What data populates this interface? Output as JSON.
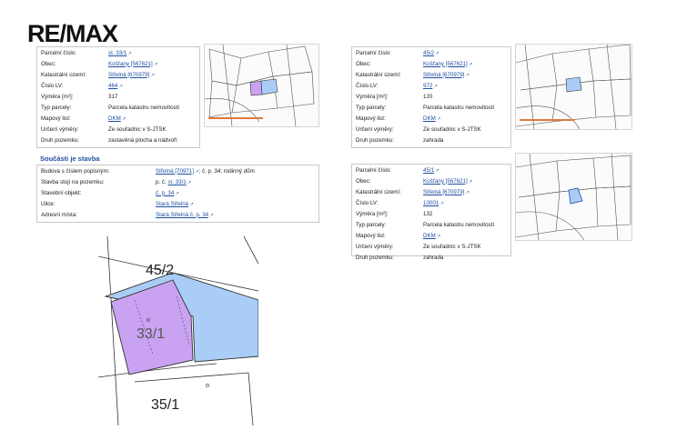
{
  "logo": {
    "brand": "RE/MAX"
  },
  "parcel1": {
    "rows": [
      {
        "label": "Parcelní číslo:",
        "value": "st. 33/1",
        "link": true
      },
      {
        "label": "Obec:",
        "value": "Košťany [567621]",
        "link": true
      },
      {
        "label": "Katastrální území:",
        "value": "Střelná [670979]",
        "link": true
      },
      {
        "label": "Číslo LV:",
        "value": "464",
        "link": true
      },
      {
        "label": "Výměra [m²]:",
        "value": "317",
        "link": false
      },
      {
        "label": "Typ parcely:",
        "value": "Parcela katastru nemovitostí",
        "link": false
      },
      {
        "label": "Mapový list:",
        "value": "DKM",
        "link": true
      },
      {
        "label": "Určení výměry:",
        "value": "Ze souřadnic v S-JTSK",
        "link": false
      },
      {
        "label": "Druh pozemku:",
        "value": "zastavěná plocha a nádvoří",
        "link": false
      }
    ]
  },
  "stavba": {
    "title": "Součásti je stavba",
    "rows": [
      {
        "label": "Budova s číslem popisným:",
        "value": "Střelná [70971]",
        "suffix": "; č. p. 34; rodinný dům",
        "link": true
      },
      {
        "label": "Stavba stojí na pozemku:",
        "prefix": "p. č.",
        "value": "st. 33/1",
        "link": true
      },
      {
        "label": "Stavební objekt:",
        "value": "č. p. 34",
        "link": true
      },
      {
        "label": "Ulice:",
        "value": "Stará Střelná",
        "link": true
      },
      {
        "label": "Adresní místa:",
        "value": "Stará Střelná č. p. 34",
        "link": true
      }
    ]
  },
  "parcel2": {
    "rows": [
      {
        "label": "Parcelní číslo:",
        "value": "45/2",
        "link": true
      },
      {
        "label": "Obec:",
        "value": "Košťany [567621]",
        "link": true
      },
      {
        "label": "Katastrální území:",
        "value": "Střelná [670979]",
        "link": true
      },
      {
        "label": "Číslo LV:",
        "value": "972",
        "link": true
      },
      {
        "label": "Výměra [m²]:",
        "value": "120",
        "link": false
      },
      {
        "label": "Typ parcely:",
        "value": "Parcela katastru nemovitostí",
        "link": false
      },
      {
        "label": "Mapový list:",
        "value": "DKM",
        "link": true
      },
      {
        "label": "Určení výměry:",
        "value": "Ze souřadnic v S-JTSK",
        "link": false
      },
      {
        "label": "Druh pozemku:",
        "value": "zahrada",
        "link": false
      }
    ]
  },
  "parcel3": {
    "rows": [
      {
        "label": "Parcelní číslo:",
        "value": "45/1",
        "link": true
      },
      {
        "label": "Obec:",
        "value": "Košťany [567621]",
        "link": true
      },
      {
        "label": "Katastrální území:",
        "value": "Střelná [670979]",
        "link": true
      },
      {
        "label": "Číslo LV:",
        "value": "10001",
        "link": true
      },
      {
        "label": "Výměra [m²]:",
        "value": "132",
        "link": false
      },
      {
        "label": "Typ parcely:",
        "value": "Parcela katastru nemovitostí",
        "link": false
      },
      {
        "label": "Mapový list:",
        "value": "DKM",
        "link": true
      },
      {
        "label": "Určení výměry:",
        "value": "Ze souřadnic v S-JTSK",
        "link": false
      },
      {
        "label": "Druh pozemku:",
        "value": "zahrada",
        "link": false
      }
    ]
  },
  "map": {
    "label_top": "45/2",
    "label_center": "33/1",
    "label_bottom": "35/1",
    "colors": {
      "purple": "#c9a2f2",
      "blue": "#a9cdf6",
      "line": "#333333"
    }
  }
}
